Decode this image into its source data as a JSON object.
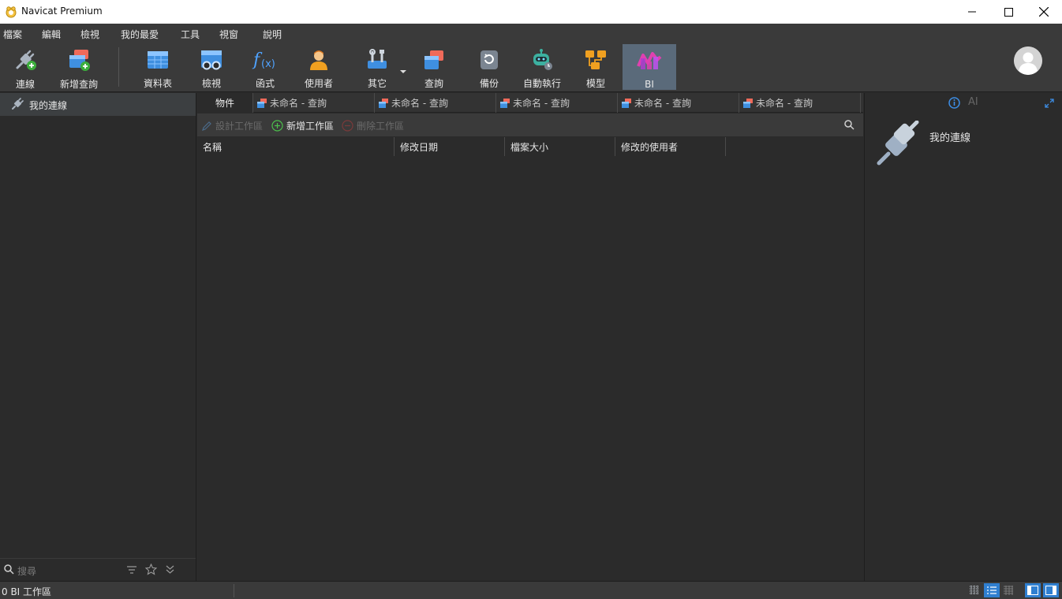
{
  "window": {
    "title": "Navicat Premium",
    "minimize_icon": "minimize-icon",
    "maximize_icon": "maximize-icon",
    "close_icon": "close-icon"
  },
  "menu": [
    "檔案",
    "編輯",
    "檢視",
    "我的最愛",
    "工具",
    "視窗",
    "說明"
  ],
  "toolbar": {
    "items": [
      {
        "label": "連線",
        "icon": "connection-plug-icon"
      },
      {
        "label": "新增查詢",
        "icon": "new-query-icon"
      },
      {
        "label": "資料表",
        "icon": "table-icon"
      },
      {
        "label": "檢視",
        "icon": "view-icon"
      },
      {
        "label": "函式",
        "icon": "function-icon"
      },
      {
        "label": "使用者",
        "icon": "user-icon"
      },
      {
        "label": "其它",
        "icon": "tools-icon"
      },
      {
        "label": "查詢",
        "icon": "query-icon"
      },
      {
        "label": "備份",
        "icon": "backup-icon"
      },
      {
        "label": "自動執行",
        "icon": "robot-icon"
      },
      {
        "label": "模型",
        "icon": "model-icon"
      },
      {
        "label": "BI",
        "icon": "bi-icon"
      }
    ],
    "active": "BI"
  },
  "left_panel": {
    "connection_label": "我的連線",
    "search_placeholder": "搜尋"
  },
  "tabs": {
    "objects": "物件",
    "query_tabs": [
      "未命名 - 查詢",
      "未命名 - 查詢",
      "未命名 - 查詢",
      "未命名 - 查詢",
      "未命名 - 查詢"
    ]
  },
  "object_toolbar": {
    "design": "設計工作區",
    "new": "新增工作區",
    "delete": "刪除工作區"
  },
  "columns": [
    "名稱",
    "修改日期",
    "檔案大小",
    "修改的使用者"
  ],
  "right_panel": {
    "ai_label": "AI",
    "title": "我的連線"
  },
  "status": {
    "text": "0 BI 工作區"
  },
  "colors": {
    "accent": "#2f7fd0",
    "active_toolbar": "#5a6a7a",
    "background": "#2b2b2b"
  }
}
